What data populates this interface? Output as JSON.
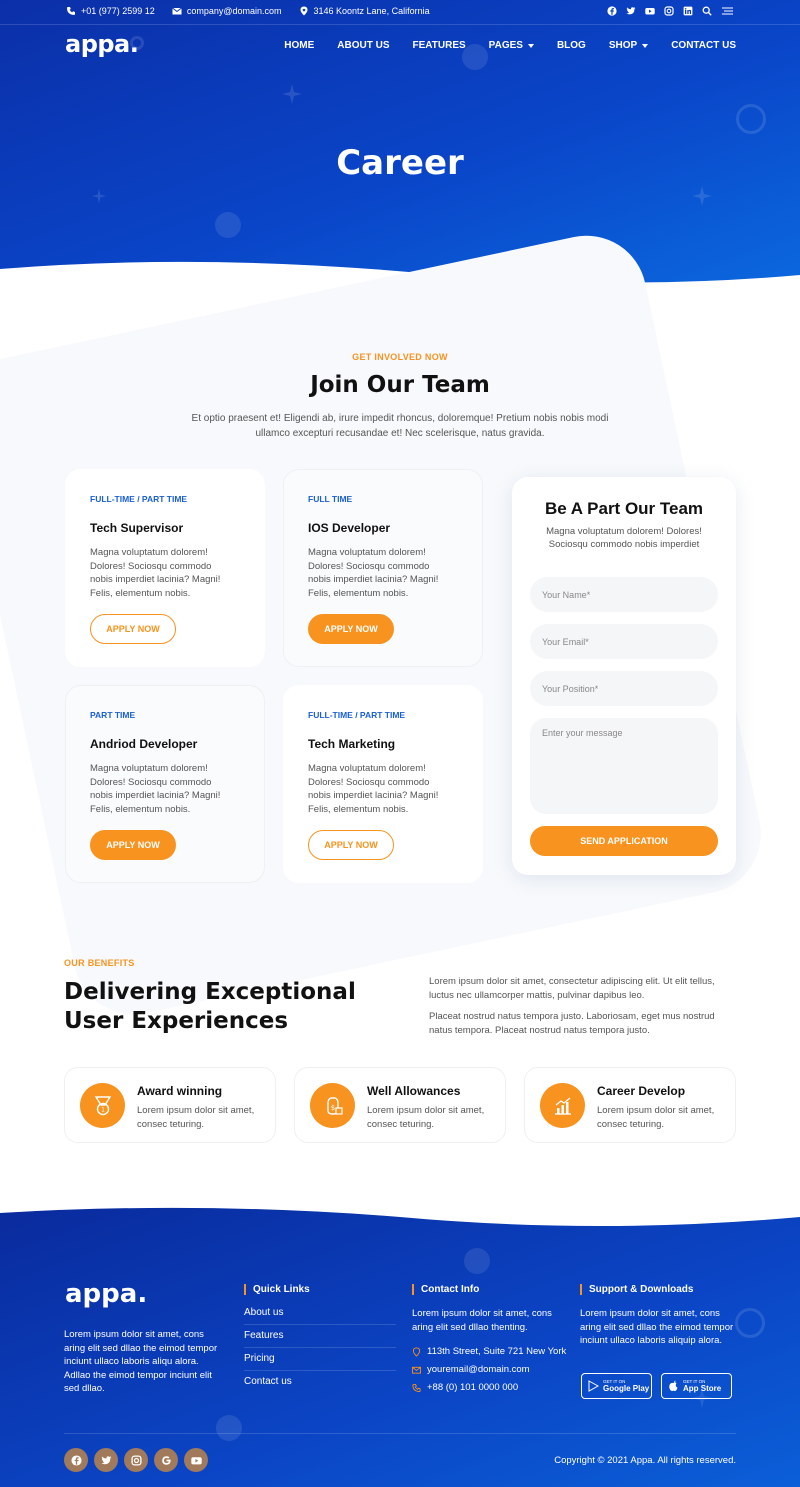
{
  "topbar": {
    "phone": "+01 (977) 2599 12",
    "email": "company@domain.com",
    "address": "3146 Koontz Lane, California"
  },
  "brand": {
    "logo": "appa."
  },
  "nav": {
    "home": "HOME",
    "about": "ABOUT US",
    "features": "FEATURES",
    "pages": "PAGES",
    "blog": "BLOG",
    "shop": "SHOP",
    "contact": "CONTACT US"
  },
  "hero": {
    "title": "Career"
  },
  "join": {
    "eyebrow": "GET INVOLVED NOW",
    "title": "Join Our Team",
    "desc": "Et optio praesent et! Eligendi ab, irure impedit rhoncus, doloremque! Pretium nobis nobis modi ullamco excepturi recusandae et! Nec scelerisque, natus gravida."
  },
  "jobs": [
    {
      "type": "FULL-TIME / PART TIME",
      "title": "Tech Supervisor",
      "desc": "Magna voluptatum dolorem! Dolores! Sociosqu commodo nobis imperdiet lacinia? Magni! Felis, elementum nobis.",
      "button": "APPLY NOW"
    },
    {
      "type": "FULL TIME",
      "title": "IOS Developer",
      "desc": "Magna voluptatum dolorem! Dolores! Sociosqu commodo nobis imperdiet lacinia? Magni! Felis, elementum nobis.",
      "button": "APPLY NOW"
    },
    {
      "type": "PART TIME",
      "title": "Andriod Developer",
      "desc": "Magna voluptatum dolorem! Dolores! Sociosqu commodo nobis imperdiet lacinia? Magni! Felis, elementum nobis.",
      "button": "APPLY NOW"
    },
    {
      "type": "FULL-TIME / PART TIME",
      "title": "Tech Marketing",
      "desc": "Magna voluptatum dolorem! Dolores! Sociosqu commodo nobis imperdiet lacinia? Magni! Felis, elementum nobis.",
      "button": "APPLY NOW"
    }
  ],
  "form": {
    "title": "Be A Part Our Team",
    "desc": "Magna voluptatum dolorem! Dolores! Sociosqu commodo nobis imperdiet",
    "name_placeholder": "Your Name*",
    "email_placeholder": "Your Email*",
    "position_placeholder": "Your Position*",
    "message_placeholder": "Enter your message",
    "submit": "SEND APPLICATION"
  },
  "benefits": {
    "eyebrow": "OUR BENEFITS",
    "title": "Delivering Exceptional User Experiences",
    "p1": "Lorem ipsum dolor sit amet, consectetur adipiscing elit. Ut elit tellus, luctus nec ullamcorper mattis, pulvinar dapibus leo.",
    "p2": "Placeat nostrud natus tempora justo. Laboriosam, eget mus nostrud natus tempora. Placeat nostrud natus tempora justo.",
    "items": [
      {
        "title": "Award winning",
        "desc": "Lorem ipsum dolor sit amet, consec teturing.",
        "icon": "medal-icon"
      },
      {
        "title": "Well Allowances",
        "desc": "Lorem ipsum dolor sit amet, consec teturing.",
        "icon": "money-icon"
      },
      {
        "title": "Career Develop",
        "desc": "Lorem ipsum dolor sit amet, consec teturing.",
        "icon": "growth-chart-icon"
      }
    ]
  },
  "footer": {
    "logo": "appa.",
    "about": "Lorem ipsum dolor sit amet, cons aring elit sed dllao the eimod tempor inciunt ullaco laboris aliqu alora. Adllao the eimod tempor inciunt elit sed dllao.",
    "quick_links_title": "Quick Links",
    "links": [
      "About us",
      "Features",
      "Pricing",
      "Contact us"
    ],
    "contact_title": "Contact Info",
    "contact_text": "Lorem ipsum dolor sit amet, cons aring elit sed dllao thenting.",
    "contact_address": "113th Street, Suite 721 New York",
    "contact_email": "youremail@domain.com",
    "contact_phone": "+88 (0) 101 0000 000",
    "support_title": "Support & Downloads",
    "support_text": "Lorem ipsum dolor sit amet, cons aring elit sed dllao the eimod tempor inciunt ullaco laboris aliquip alora.",
    "gplay_small": "GET IT ON",
    "gplay_big": "Google Play",
    "appstore_small": "GET IT ON",
    "appstore_big": "App Store",
    "copyright": "Copyright © 2021 Appa. All rights reserved."
  },
  "colors": {
    "primary": "#0b45c5",
    "accent": "#f7931e",
    "link_blue": "#1a5fd6"
  }
}
